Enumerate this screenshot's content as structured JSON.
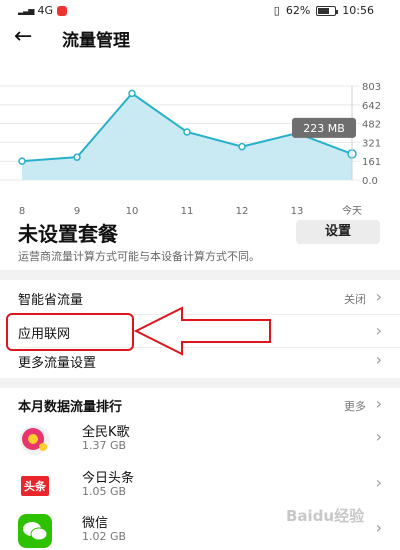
{
  "status": {
    "carrier": "4G",
    "battery": "62%",
    "time": "10:56"
  },
  "header": {
    "title": "流量管理"
  },
  "chart_data": {
    "type": "area",
    "x": [
      "8",
      "9",
      "10",
      "11",
      "12",
      "13",
      "今天"
    ],
    "values": [
      161,
      195,
      740,
      410,
      285,
      400,
      223
    ],
    "yticks": [
      "803",
      "642",
      "482",
      "321",
      "161",
      "0.0"
    ],
    "ylim": [
      0,
      803
    ],
    "tooltip": "223 MB",
    "colors": {
      "line": "#27b0c9",
      "fill": "#bfe6f1",
      "grid": "#e8e8e8"
    }
  },
  "plan": {
    "title": "未设置套餐",
    "button_label": "设置",
    "note": "运营商流量计算方式可能与本设备计算方式不同。"
  },
  "settings": {
    "smart_saver": {
      "label": "智能省流量",
      "value": "关闭"
    },
    "app_network": {
      "label": "应用联网"
    },
    "more_settings": {
      "label": "更多流量设置"
    }
  },
  "ranking": {
    "title": "本月数据流量排行",
    "more": "更多",
    "apps": [
      {
        "name": "全民K歌",
        "size": "1.37 GB",
        "icon": "kge-icon"
      },
      {
        "name": "今日头条",
        "size": "1.05 GB",
        "icon": "toutiao-icon",
        "icon_text": "头条"
      },
      {
        "name": "微信",
        "size": "1.02 GB",
        "icon": "wechat-icon"
      }
    ]
  },
  "watermark": "Baidu经验"
}
